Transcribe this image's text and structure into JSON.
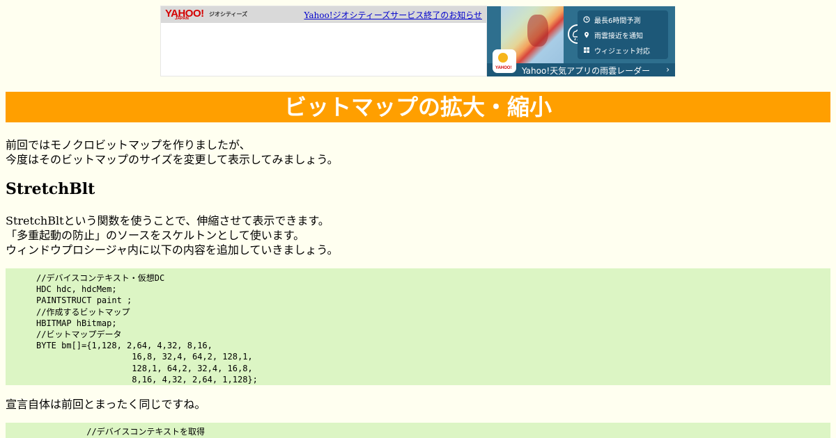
{
  "banner": {
    "logo_text": "YAHOO!",
    "logo_sub": "JAPAN",
    "service_name": "ジオシティーズ",
    "notice_link": "Yahoo!ジオシティーズサービス終了のお知らせ"
  },
  "weather_ad": {
    "features": [
      {
        "icon": "clock-icon",
        "label": "最長6時間予測"
      },
      {
        "icon": "location-pin-icon",
        "label": "雨雲接近を通知"
      },
      {
        "icon": "widget-grid-icon",
        "label": "ウィジェット対応"
      }
    ],
    "app_icon_text": "YAHOO!",
    "cta_label": "Yahoo!天気アプリの雨雲レーダー",
    "cta_chevron": "›"
  },
  "page": {
    "title": "ビットマップの拡大・縮小",
    "intro_lines": [
      "前回ではモノクロビットマップを作りましたが、",
      "今度はそのビットマップのサイズを変更して表示してみましょう。"
    ],
    "section_heading": "StretchBlt",
    "desc_lines": [
      "StretchBltという関数を使うことで、伸縮させて表示できます。",
      "「多重起動の防止」のソースをスケルトンとして使います。",
      "ウィンドウプロシージャ内に以下の内容を追加していきましょう。"
    ],
    "code_block_1": "//デバイスコンテキスト・仮想DC\nHDC hdc, hdcMem;\nPAINTSTRUCT paint ;\n//作成するビットマップ\nHBITMAP hBitmap;\n//ビットマップデータ\nBYTE bm[]={1,128, 2,64, 4,32, 8,16,\n                   16,8, 32,4, 64,2, 128,1,\n                   128,1, 64,2, 32,4, 16,8,\n                   8,16, 4,32, 2,64, 1,128};",
    "after_code": "宣言自体は前回とまったく同じですね。",
    "code_block_2": "          //デバイスコンテキストを取得"
  }
}
